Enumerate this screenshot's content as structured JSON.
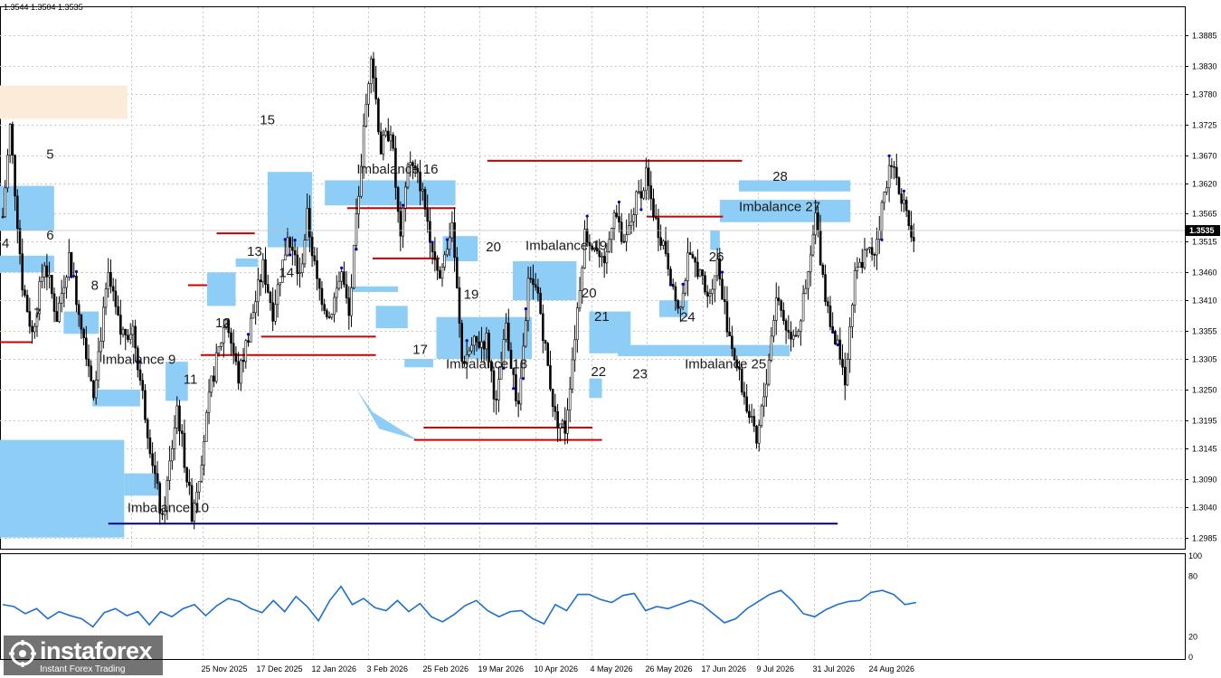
{
  "header": {
    "ohlc": "1.3544 1.3504 1.3535"
  },
  "watermark": {
    "brand": "instaforex",
    "tagline": "Instant Forex Trading"
  },
  "chart_data": {
    "type": "candlestick",
    "symbol_quote": "1.3535",
    "ylim": [
      1.2965,
      1.3935
    ],
    "price_ticks": [
      "1.3885",
      "1.3830",
      "1.3780",
      "1.3725",
      "1.3670",
      "1.3620",
      "1.3565",
      "1.3515",
      "1.3460",
      "1.3410",
      "1.3355",
      "1.3305",
      "1.3250",
      "1.3195",
      "1.3145",
      "1.3090",
      "1.3040",
      "1.2985"
    ],
    "date_ticks": [
      "25 Nov 2025",
      "17 Dec 2025",
      "12 Jan 2026",
      "3 Feb 2026",
      "25 Feb 2026",
      "19 Mar 2026",
      "10 Apr 2026",
      "4 May 2026",
      "26 May 2026",
      "17 Jun 2026",
      "9 Jul 2026",
      "31 Jul 2026",
      "24 Aug 2026"
    ],
    "date_tick_positions": [
      0.1712,
      0.2178,
      0.2642,
      0.3108,
      0.3581,
      0.4048,
      0.4521,
      0.4989,
      0.546,
      0.5928,
      0.6398,
      0.6874,
      0.7342
    ],
    "x_days_span": [
      0,
      310
    ],
    "price_path": [
      [
        0,
        1.356
      ],
      [
        3,
        1.372
      ],
      [
        8,
        1.344
      ],
      [
        12,
        1.335
      ],
      [
        17,
        1.348
      ],
      [
        22,
        1.338
      ],
      [
        27,
        1.349
      ],
      [
        32,
        1.337
      ],
      [
        37,
        1.325
      ],
      [
        43,
        1.345
      ],
      [
        48,
        1.335
      ],
      [
        53,
        1.336
      ],
      [
        59,
        1.318
      ],
      [
        65,
        1.301
      ],
      [
        71,
        1.322
      ],
      [
        77,
        1.303
      ],
      [
        80,
        1.31
      ],
      [
        85,
        1.326
      ],
      [
        91,
        1.338
      ],
      [
        96,
        1.327
      ],
      [
        101,
        1.337
      ],
      [
        106,
        1.347
      ],
      [
        110,
        1.339
      ],
      [
        116,
        1.352
      ],
      [
        121,
        1.345
      ],
      [
        124,
        1.356
      ],
      [
        128,
        1.344
      ],
      [
        133,
        1.338
      ],
      [
        138,
        1.346
      ],
      [
        141,
        1.338
      ],
      [
        146,
        1.366
      ],
      [
        150,
        1.386
      ],
      [
        154,
        1.368
      ],
      [
        158,
        1.372
      ],
      [
        162,
        1.351
      ],
      [
        165,
        1.366
      ],
      [
        170,
        1.362
      ],
      [
        174,
        1.353
      ],
      [
        178,
        1.345
      ],
      [
        183,
        1.355
      ],
      [
        187,
        1.33
      ],
      [
        192,
        1.333
      ],
      [
        197,
        1.334
      ],
      [
        201,
        1.322
      ],
      [
        205,
        1.336
      ],
      [
        210,
        1.321
      ],
      [
        214,
        1.344
      ],
      [
        218,
        1.342
      ],
      [
        222,
        1.329
      ],
      [
        225,
        1.32
      ],
      [
        229,
        1.318
      ],
      [
        233,
        1.335
      ],
      [
        237,
        1.353
      ],
      [
        241,
        1.351
      ],
      [
        245,
        1.346
      ],
      [
        249,
        1.358
      ],
      [
        253,
        1.35
      ],
      [
        258,
        1.359
      ],
      [
        262,
        1.363
      ],
      [
        266,
        1.355
      ],
      [
        270,
        1.35
      ],
      [
        275,
        1.339
      ],
      [
        279,
        1.348
      ],
      [
        283,
        1.347
      ],
      [
        287,
        1.341
      ],
      [
        291,
        1.348
      ],
      [
        295,
        1.337
      ],
      [
        299,
        1.329
      ],
      [
        303,
        1.322
      ],
      [
        307,
        1.315
      ],
      [
        311,
        1.327
      ],
      [
        315,
        1.342
      ],
      [
        320,
        1.335
      ],
      [
        324,
        1.336
      ],
      [
        328,
        1.345
      ],
      [
        331,
        1.356
      ],
      [
        335,
        1.342
      ],
      [
        339,
        1.334
      ],
      [
        343,
        1.327
      ],
      [
        347,
        1.345
      ],
      [
        351,
        1.349
      ],
      [
        355,
        1.35
      ],
      [
        359,
        1.36
      ],
      [
        362,
        1.366
      ],
      [
        366,
        1.36
      ],
      [
        369,
        1.353
      ],
      [
        372,
        1.349
      ]
    ],
    "pivot_labels": [
      {
        "text": "4",
        "x": 0,
        "y": 1.3512
      },
      {
        "text": "5",
        "x": 14,
        "y": 1.3672
      },
      {
        "text": "6",
        "x": 14,
        "y": 1.3527
      },
      {
        "text": "7",
        "x": 10,
        "y": 1.3387
      },
      {
        "text": "8",
        "x": 28,
        "y": 1.3437
      },
      {
        "text": "11",
        "x": 57,
        "y": 1.3269
      },
      {
        "text": "12",
        "x": 67,
        "y": 1.337
      },
      {
        "text": "13",
        "x": 77,
        "y": 1.3498
      },
      {
        "text": "14",
        "x": 87,
        "y": 1.346
      },
      {
        "text": "15",
        "x": 81,
        "y": 1.3733
      },
      {
        "text": "17",
        "x": 129,
        "y": 1.3322
      },
      {
        "text": "19",
        "x": 145,
        "y": 1.3421
      },
      {
        "text": "20",
        "x": 152,
        "y": 1.3506
      },
      {
        "text": "20",
        "x": 182,
        "y": 1.3423
      },
      {
        "text": "21",
        "x": 186,
        "y": 1.3381
      },
      {
        "text": "22",
        "x": 185,
        "y": 1.3282
      },
      {
        "text": "23",
        "x": 198,
        "y": 1.3278
      },
      {
        "text": "24",
        "x": 213,
        "y": 1.338
      },
      {
        "text": "26",
        "x": 222,
        "y": 1.3488
      },
      {
        "text": "28",
        "x": 242,
        "y": 1.3632
      }
    ],
    "imbalance_labels": [
      {
        "text": "Imbalance 9",
        "x": 32,
        "y": 1.3304
      },
      {
        "text": "Imbalance 10",
        "x": 40,
        "y": 1.3039
      },
      {
        "text": "Imbalance 16",
        "x": 112,
        "y": 1.3645
      },
      {
        "text": "Imbalance 18",
        "x": 140,
        "y": 1.3296
      },
      {
        "text": "Imbalance 19",
        "x": 165,
        "y": 1.3508
      },
      {
        "text": "Imbalance 25",
        "x": 215,
        "y": 1.3296
      },
      {
        "text": "Imbalance 27",
        "x": 232,
        "y": 1.3578
      }
    ],
    "zones": [
      {
        "x0": 0,
        "x1": 40,
        "y0": 1.3735,
        "y1": 1.3795,
        "color": "#fcebd8"
      },
      {
        "x0": 0,
        "x1": 17,
        "y0": 1.3535,
        "y1": 1.3615,
        "color": "#8ecdf5"
      },
      {
        "x0": 0,
        "x1": 17,
        "y0": 1.346,
        "y1": 1.349,
        "color": "#8ecdf5"
      },
      {
        "x0": 20,
        "x1": 31,
        "y0": 1.335,
        "y1": 1.339,
        "color": "#8ecdf5"
      },
      {
        "x0": 29,
        "x1": 44,
        "y0": 1.322,
        "y1": 1.325,
        "color": "#8ecdf5"
      },
      {
        "x0": 0,
        "x1": 39,
        "y0": 1.2985,
        "y1": 1.316,
        "color": "#8ecdf5"
      },
      {
        "x0": 39,
        "x1": 50,
        "y0": 1.306,
        "y1": 1.31,
        "color": "#8ecdf5"
      },
      {
        "x0": 52,
        "x1": 59,
        "y0": 1.323,
        "y1": 1.33,
        "color": "#8ecdf5"
      },
      {
        "x0": 65,
        "x1": 74,
        "y0": 1.34,
        "y1": 1.346,
        "color": "#8ecdf5"
      },
      {
        "x0": 74,
        "x1": 81,
        "y0": 1.347,
        "y1": 1.3485,
        "color": "#8ecdf5"
      },
      {
        "x0": 84,
        "x1": 98,
        "y0": 1.3505,
        "y1": 1.364,
        "color": "#8ecdf5"
      },
      {
        "x0": 102,
        "x1": 143,
        "y0": 1.358,
        "y1": 1.3625,
        "color": "#8ecdf5"
      },
      {
        "x0": 110,
        "x1": 125,
        "y0": 1.3425,
        "y1": 1.3435,
        "color": "#8ecdf5"
      },
      {
        "x0": 118,
        "x1": 128,
        "y0": 1.336,
        "y1": 1.34,
        "color": "#8ecdf5"
      },
      {
        "x0": 127,
        "x1": 136,
        "y0": 1.329,
        "y1": 1.3305,
        "color": "#8ecdf5"
      },
      {
        "x0": 137,
        "x1": 167,
        "y0": 1.3305,
        "y1": 1.338,
        "color": "#8ecdf5"
      },
      {
        "x0": 139,
        "x1": 150,
        "y0": 1.348,
        "y1": 1.3525,
        "color": "#8ecdf5"
      },
      {
        "x0": 161,
        "x1": 181,
        "y0": 1.341,
        "y1": 1.348,
        "color": "#8ecdf5"
      },
      {
        "x0": 185,
        "x1": 198,
        "y0": 1.3315,
        "y1": 1.339,
        "color": "#8ecdf5"
      },
      {
        "x0": 185,
        "x1": 189,
        "y0": 1.3235,
        "y1": 1.327,
        "color": "#8ecdf5"
      },
      {
        "x0": 194,
        "x1": 212,
        "y0": 1.331,
        "y1": 1.333,
        "color": "#8ecdf5"
      },
      {
        "x0": 207,
        "x1": 216,
        "y0": 1.338,
        "y1": 1.341,
        "color": "#8ecdf5"
      },
      {
        "x0": 212,
        "x1": 248,
        "y0": 1.331,
        "y1": 1.333,
        "color": "#8ecdf5"
      },
      {
        "x0": 223,
        "x1": 226,
        "y0": 1.35,
        "y1": 1.3535,
        "color": "#8ecdf5"
      },
      {
        "x0": 226,
        "x1": 267,
        "y0": 1.355,
        "y1": 1.359,
        "color": "#8ecdf5"
      },
      {
        "x0": 232,
        "x1": 267,
        "y0": 1.3605,
        "y1": 1.3625,
        "color": "#8ecdf5"
      }
    ],
    "red_levels": [
      {
        "x0": 0,
        "x1": 10,
        "y": 1.3335
      },
      {
        "x0": 59,
        "x1": 65,
        "y": 1.3437
      },
      {
        "x0": 68,
        "x1": 80,
        "y": 1.353
      },
      {
        "x0": 63,
        "x1": 118,
        "y": 1.3312
      },
      {
        "x0": 82,
        "x1": 118,
        "y": 1.3345
      },
      {
        "x0": 109,
        "x1": 143,
        "y": 1.3575
      },
      {
        "x0": 117,
        "x1": 138,
        "y": 1.3485
      },
      {
        "x0": 133,
        "x1": 186,
        "y": 1.3182
      },
      {
        "x0": 130,
        "x1": 189,
        "y": 1.316
      },
      {
        "x0": 153,
        "x1": 233,
        "y": 1.366
      },
      {
        "x0": 203,
        "x1": 227,
        "y": 1.356
      }
    ],
    "blue_level": {
      "x0": 34,
      "x1": 263,
      "y": 1.301
    },
    "wedge": [
      [
        112,
        1.325
      ],
      [
        119,
        1.318
      ],
      [
        131,
        1.316
      ],
      [
        117,
        1.321
      ]
    ],
    "indicator": {
      "scale_labels": [
        "100",
        "80",
        "20",
        "0"
      ],
      "values": [
        52,
        50,
        43,
        48,
        38,
        45,
        41,
        38,
        30,
        44,
        48,
        41,
        45,
        32,
        45,
        40,
        48,
        52,
        41,
        51,
        58,
        55,
        48,
        44,
        56,
        45,
        60,
        50,
        36,
        56,
        70,
        52,
        58,
        49,
        46,
        56,
        45,
        53,
        40,
        35,
        42,
        51,
        56,
        46,
        40,
        45,
        46,
        38,
        33,
        52,
        46,
        62,
        62,
        57,
        54,
        61,
        63,
        46,
        50,
        48,
        52,
        56,
        52,
        43,
        34,
        38,
        48,
        55,
        62,
        66,
        56,
        43,
        40,
        47,
        52,
        55,
        56,
        64,
        66,
        62,
        52,
        54
      ]
    }
  }
}
